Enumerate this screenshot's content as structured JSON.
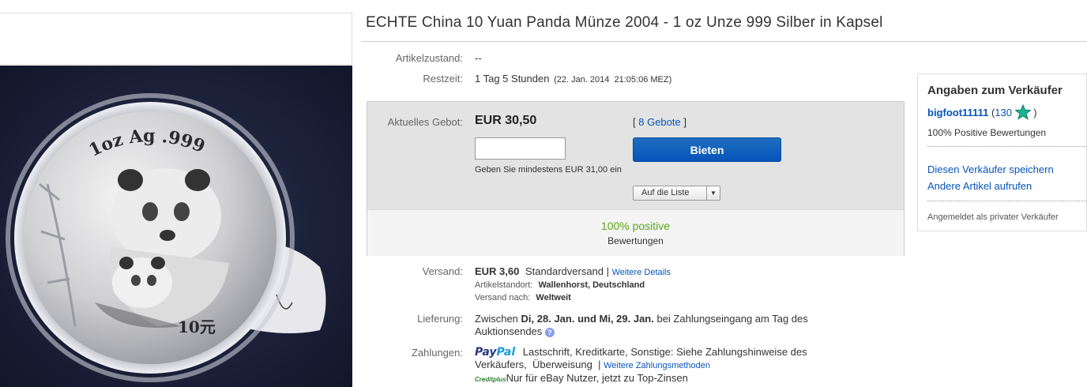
{
  "listing": {
    "title": "ECHTE China 10 Yuan Panda Münze 2004 - 1 oz Unze 999 Silber in Kapsel"
  },
  "coin": {
    "inscription": "1oz Ag .999",
    "value_mark": "10元"
  },
  "details": {
    "condition_label": "Artikelzustand:",
    "condition_value": "--",
    "time_label": "Restzeit:",
    "time_value": "1 Tag 5 Stunden",
    "time_end": "(22. Jan. 2014  21:05:06 MEZ)"
  },
  "bid": {
    "current_label": "Aktuelles Gebot:",
    "current_value": "EUR 30,50",
    "bracket_open": "[",
    "bids_count": "8 Gebote",
    "bracket_close": "]",
    "input_value": "",
    "bid_button": "Bieten",
    "min_hint": "Geben Sie mindestens EUR 31,00 ein",
    "watch_button": "Auf die Liste",
    "positive": "100% positive",
    "ratings": "Bewertungen"
  },
  "shipping": {
    "label": "Versand:",
    "price": "EUR 3,60",
    "method": "Standardversand |",
    "more_link": "Weitere Details",
    "location_label": "Artikelstandort:",
    "location_value": "Wallenhorst, Deutschland",
    "to_label": "Versand nach:",
    "to_value": "Weltweit"
  },
  "delivery": {
    "label": "Lieferung:",
    "line1_prefix": "Zwischen ",
    "line1_bold": "Di, 28. Jan. und Mi, 29. Jan.",
    "line1_suffix": " bei Zahlungseingang am Tag des",
    "line2": "Auktionsendes"
  },
  "payment": {
    "label": "Zahlungen:",
    "paypal_a": "Pay",
    "paypal_b": "Pal",
    "line1": "Lastschrift,  Kreditkarte,  Sonstige: Siehe Zahlungshinweise des",
    "line2": "Verkäufers,  Überweisung  |",
    "more_link": "Weitere Zahlungsmethoden",
    "credit_logo": "Creditplus",
    "credit_text": "Nur für eBay Nutzer, jetzt zu Top-Zinsen"
  },
  "seller": {
    "heading": "Angaben zum Verkäufer",
    "name": "bigfoot11111",
    "score_open": "(",
    "score": "130",
    "score_close": ")",
    "feedback": "100% Positive Bewertungen",
    "save_link": "Diesen Verkäufer speichern",
    "other_link": "Andere Artikel aufrufen",
    "registered": "Angemeldet als privater Verkäufer"
  },
  "colors": {
    "link": "#0654ba",
    "positive": "#5ba71b",
    "button": "#0654ba",
    "star": "#1ab394"
  }
}
